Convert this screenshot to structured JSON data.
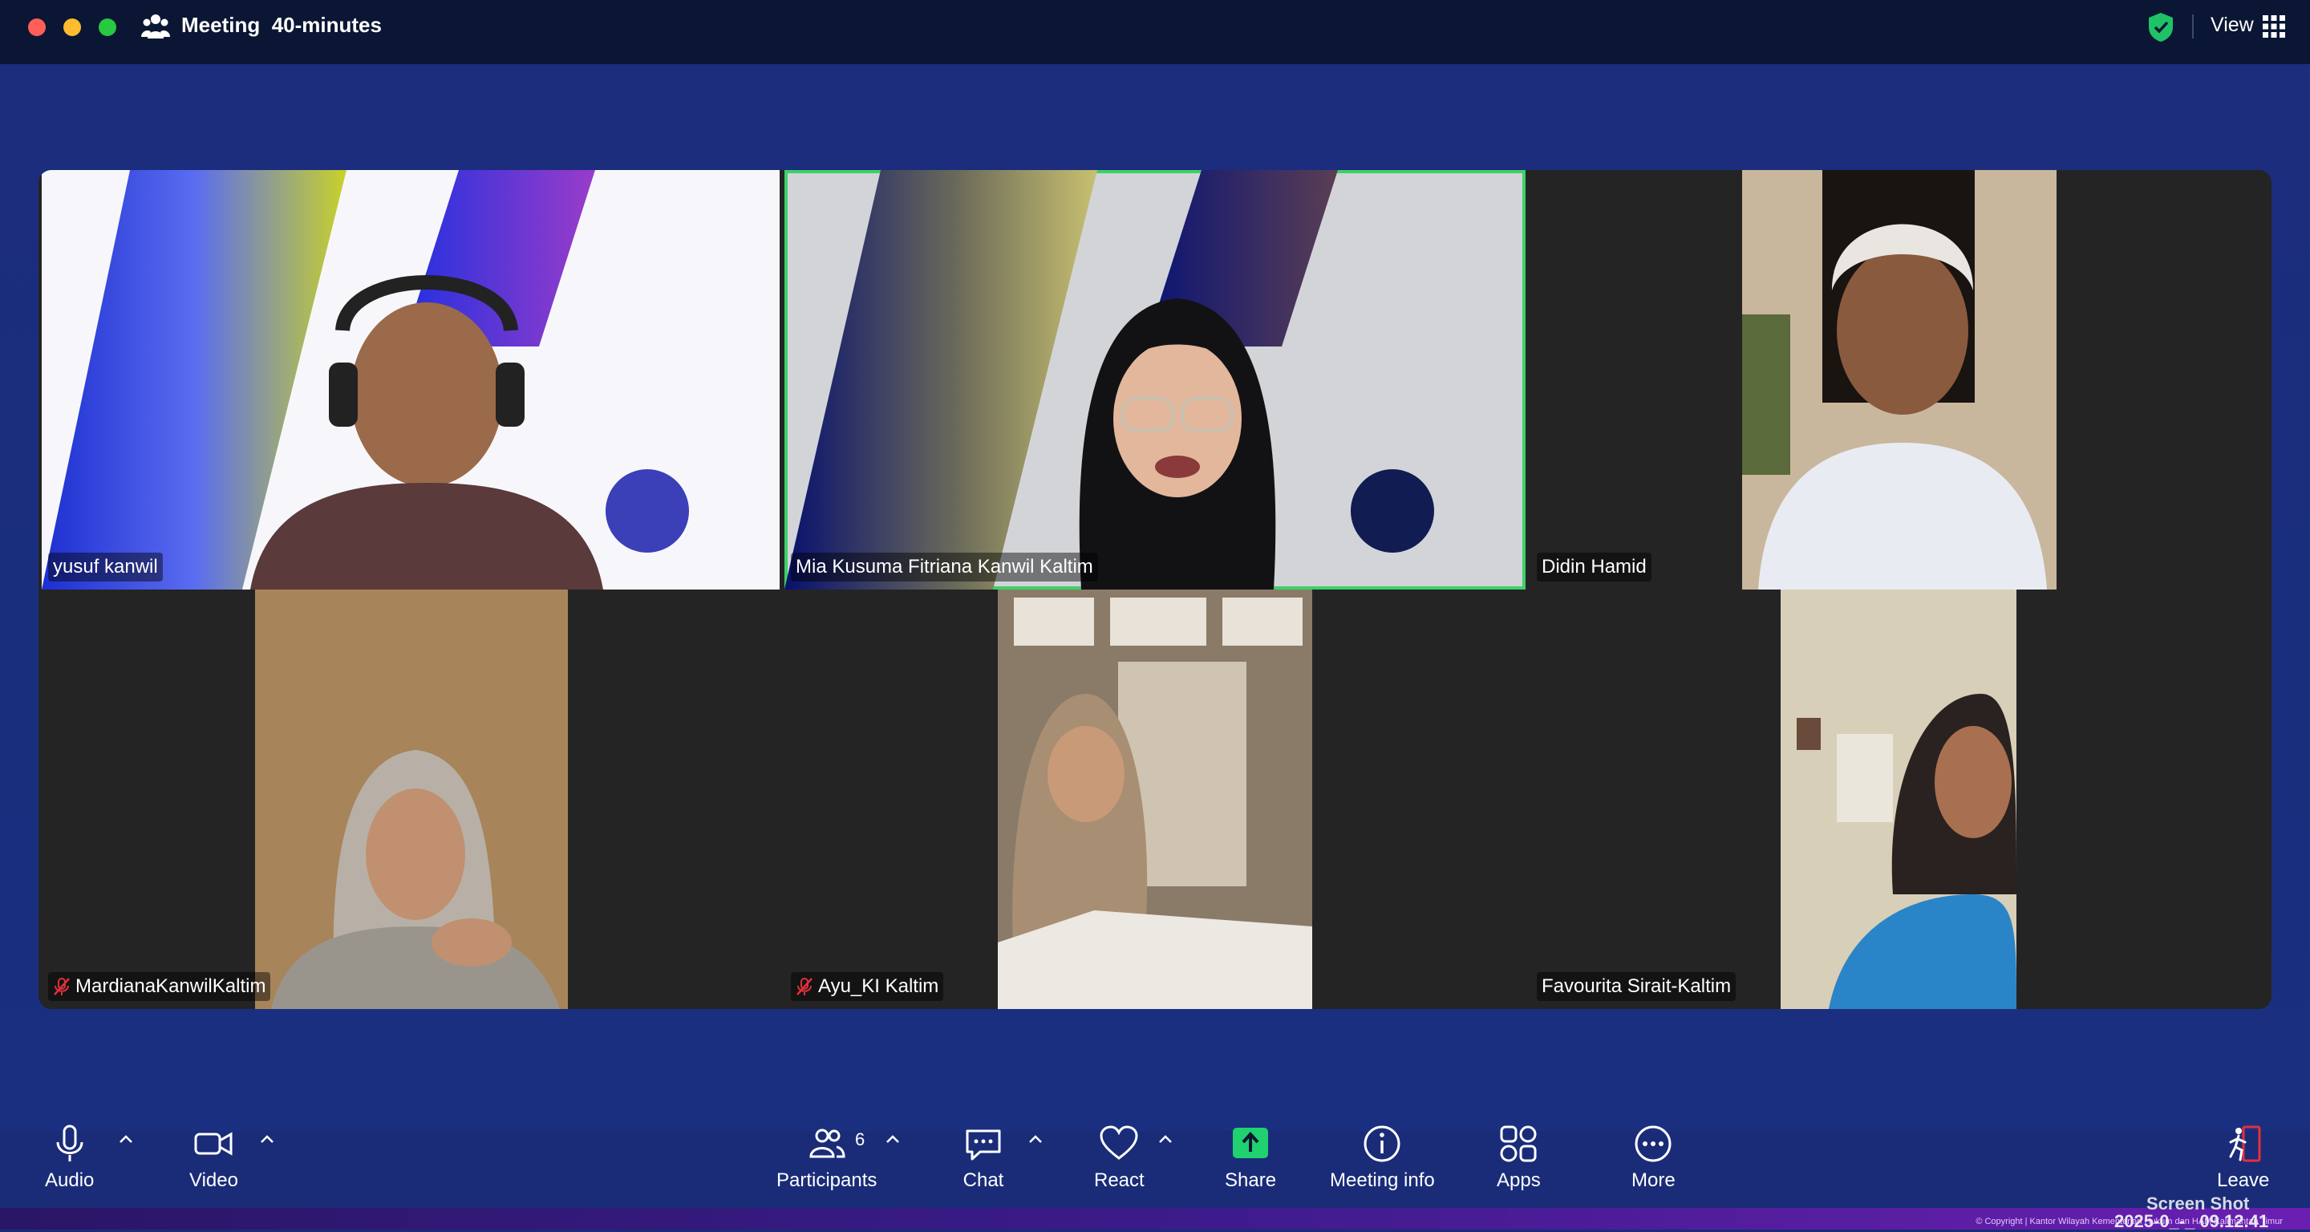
{
  "window": {
    "title": "Meeting",
    "subtitle": "40-minutes",
    "view_label": "View"
  },
  "participants": [
    {
      "name": "yusuf kanwil",
      "muted": false,
      "active": false
    },
    {
      "name": "Mia Kusuma Fitriana Kanwil Kaltim",
      "muted": false,
      "active": true
    },
    {
      "name": "Didin Hamid",
      "muted": false,
      "active": false
    },
    {
      "name": "MardianaKanwilKaltim",
      "muted": true,
      "active": false
    },
    {
      "name": "Ayu_KI Kaltim",
      "muted": true,
      "active": false
    },
    {
      "name": "Favourita Sirait-Kaltim",
      "muted": false,
      "active": false
    }
  ],
  "toolbar": {
    "audio": "Audio",
    "video": "Video",
    "participants": "Participants",
    "participants_count": "6",
    "chat": "Chat",
    "react": "React",
    "share": "Share",
    "meeting_info": "Meeting info",
    "apps": "Apps",
    "more": "More",
    "leave": "Leave"
  },
  "footer": {
    "screenshot_label": "Screen Shot",
    "screenshot_time": "2025-0_-_ 09.12.41",
    "copyright": "© Copyright | Kantor Wilayah Kementerian Hukum dan HAM Kalimantan Timur"
  },
  "colors": {
    "accent_green": "#3fd068",
    "share_green": "#1fd16f",
    "leave_red": "#e6303a",
    "muted_red": "#e0313b"
  }
}
